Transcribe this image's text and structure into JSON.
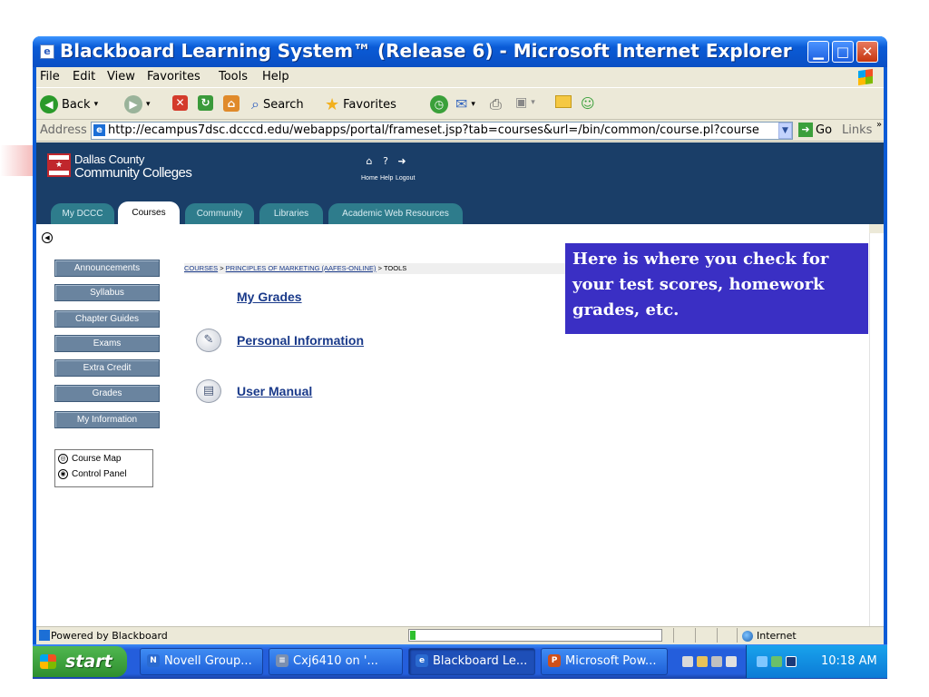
{
  "window": {
    "title": "Blackboard Learning System™ (Release 6) - Microsoft Internet Explorer",
    "icon": "ie-page-icon",
    "controls": [
      "minimize",
      "maximize",
      "close"
    ]
  },
  "menu": [
    "File",
    "Edit",
    "View",
    "Favorites",
    "Tools",
    "Help"
  ],
  "toolbar": {
    "back": "Back",
    "search": "Search",
    "favorites": "Favorites"
  },
  "address": {
    "label": "Address",
    "url": "http://ecampus7dsc.dcccd.edu/webapps/portal/frameset.jsp?tab=courses&url=/bin/common/course.pl?course",
    "go": "Go",
    "links": "Links"
  },
  "header": {
    "logo_line1": "Dallas County",
    "logo_line2": "Community Colleges",
    "home": "Home",
    "help": "Help",
    "logout": "Logout",
    "tabs": [
      "My DCCC",
      "Courses",
      "Community",
      "Libraries",
      "Academic Web Resources"
    ],
    "active_tab": "Courses"
  },
  "course_nav": {
    "buttons": [
      "Announcements",
      "Syllabus",
      "Chapter Guides",
      "Exams",
      "Extra Credit",
      "Grades",
      "My Information"
    ],
    "tools": [
      "Course Map",
      "Control Panel"
    ]
  },
  "breadcrumb": {
    "courses": "COURSES",
    "course": "PRINCIPLES OF MARKETING (AAFES-ONLINE)",
    "current": "> TOOLS",
    "sep": ">"
  },
  "content_links": [
    "My Grades",
    "Personal Information",
    "User Manual"
  ],
  "callout": "Here is where you check for your test scores, homework grades, etc.",
  "status": {
    "text": "Powered by Blackboard",
    "zone": "Internet",
    "progress": 0.02
  },
  "taskbar": {
    "start": "start",
    "tasks": [
      "Novell Group...",
      "Cxj6410 on '...",
      "Blackboard Le...",
      "Microsoft Pow..."
    ],
    "active_task": "Blackboard Le...",
    "clock": "10:18 AM"
  },
  "colors": {
    "title_blue": "#0a5bd6",
    "header_navy": "#1a3e68",
    "tab_teal": "#2e7c8c",
    "nav_button": "#6a849f",
    "callout_bg": "#3a2fc4",
    "link": "#1a3a8a"
  }
}
